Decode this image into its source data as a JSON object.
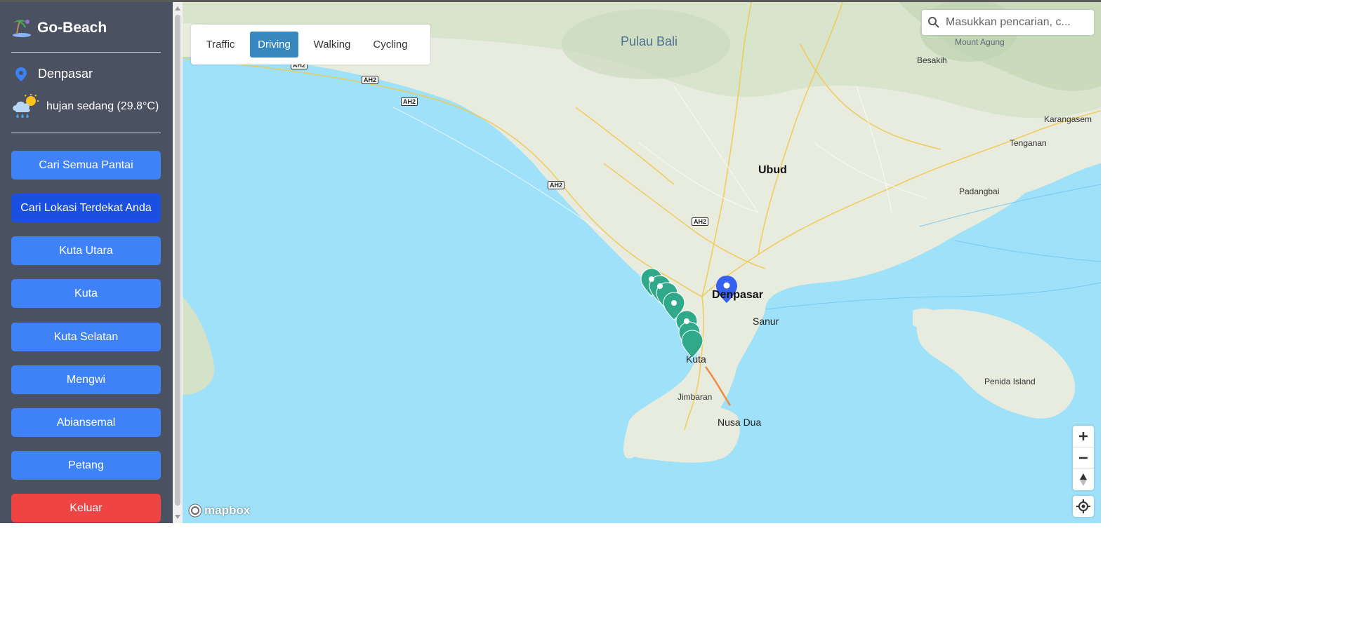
{
  "app": {
    "brand_title": "Go-Beach",
    "location": "Denpasar",
    "weather": "hujan sedang (29.8°C)"
  },
  "sidebar": {
    "buttons": [
      {
        "label": "Cari Semua Pantai",
        "state": "default"
      },
      {
        "label": "Cari Lokasi Terdekat Anda",
        "state": "active"
      },
      {
        "label": "Kuta Utara",
        "state": "default"
      },
      {
        "label": "Kuta",
        "state": "default"
      },
      {
        "label": "Kuta Selatan",
        "state": "default"
      },
      {
        "label": "Mengwi",
        "state": "default"
      },
      {
        "label": "Abiansemal",
        "state": "default"
      },
      {
        "label": "Petang",
        "state": "default"
      },
      {
        "label": "Keluar",
        "state": "danger"
      }
    ]
  },
  "map_mode": {
    "tabs": [
      "Traffic",
      "Driving",
      "Walking",
      "Cycling"
    ],
    "selected": "Driving"
  },
  "search": {
    "placeholder": "Masukkan pencarian, c..."
  },
  "map": {
    "labels": {
      "pulau_bali": "Pulau Bali",
      "mount_agung": "Mount Agung",
      "besakih": "Besakih",
      "karangasem": "Karangasem",
      "tenganan": "Tenganan",
      "padangbai": "Padangbai",
      "ubud": "Ubud",
      "denpasar": "Denpasar",
      "sanur": "Sanur",
      "kuta": "Kuta",
      "jimbaran": "Jimbaran",
      "nusa_dua": "Nusa Dua",
      "penida_island": "Penida Island"
    },
    "road_badges": [
      "AH2",
      "AH2",
      "AH2",
      "AH2",
      "AH2"
    ],
    "attribution": "mapbox"
  },
  "colors": {
    "sidebar_bg": "#4a5160",
    "button_blue": "#3f82f7",
    "button_active": "#1a4fe0",
    "button_danger": "#ee4444",
    "mode_active": "#3887be",
    "water": "#9ee1f8",
    "beach_marker": "#2fa98a",
    "user_marker": "#3560f0"
  },
  "icons": {
    "brand": "beach-umbrella-icon",
    "location": "map-pin-icon",
    "weather": "rain-cloud-sun-icon",
    "search": "search-icon",
    "zoom_in": "plus-icon",
    "zoom_out": "minus-icon",
    "compass": "compass-icon",
    "geolocate": "geolocate-icon"
  }
}
